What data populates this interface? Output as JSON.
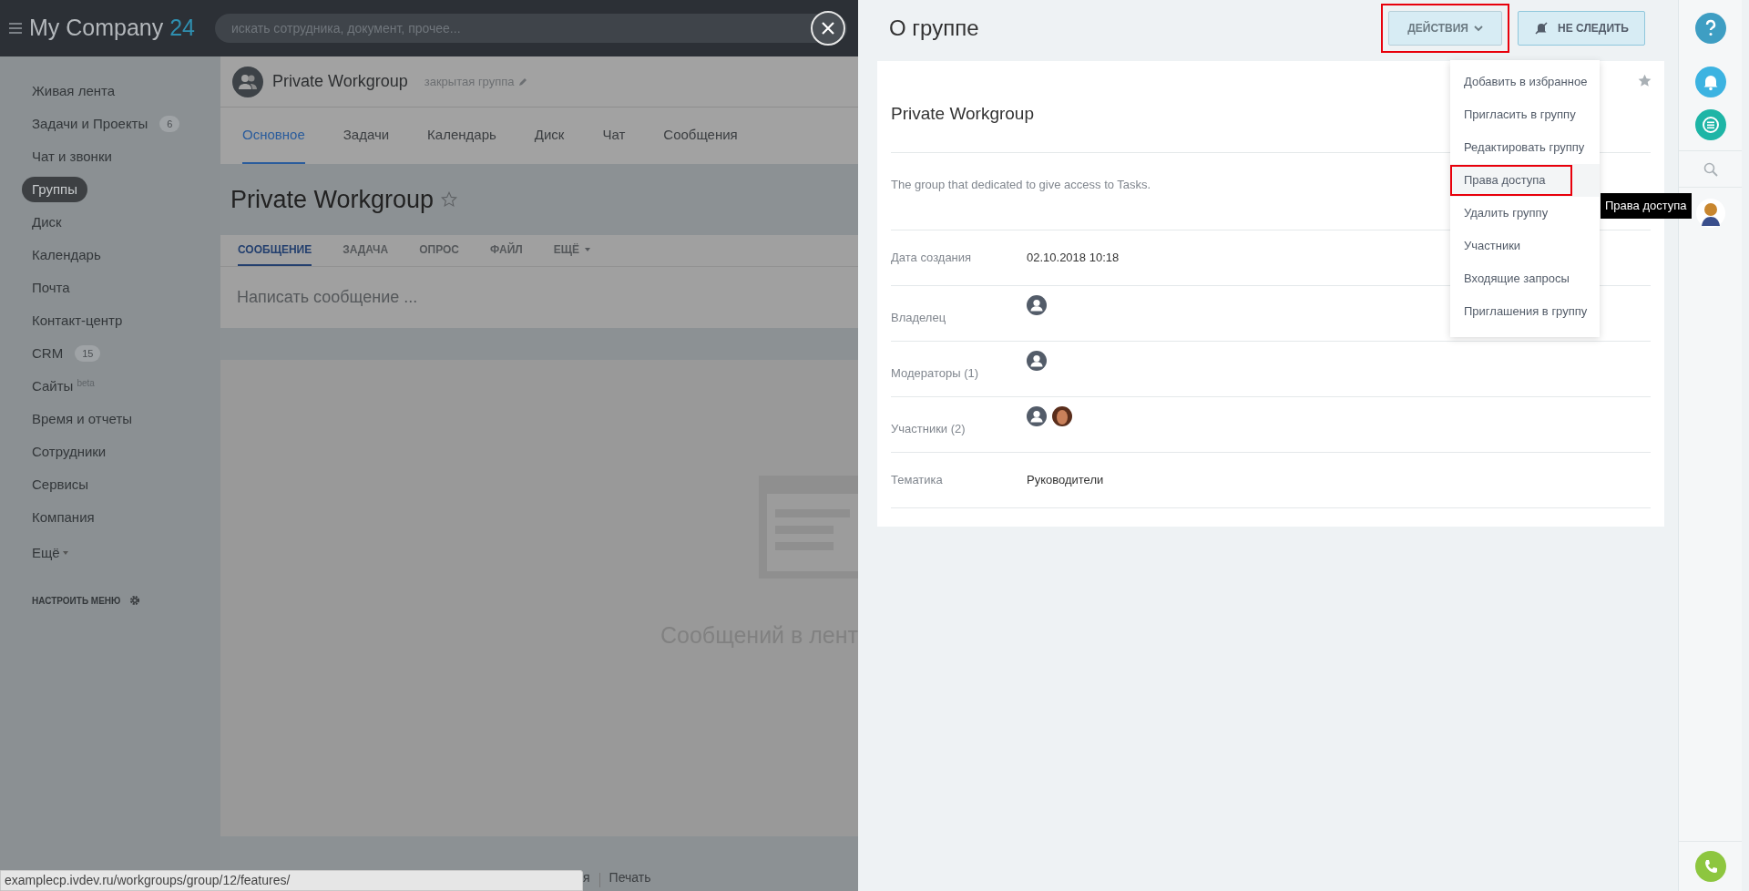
{
  "header": {
    "logo": "My Company",
    "logo_number": "24",
    "search_placeholder": "искать сотрудника, документ, прочее..."
  },
  "sidebar": {
    "items": [
      {
        "label": "Живая лента",
        "selected": false
      },
      {
        "label": "Задачи и Проекты",
        "badge": "6",
        "selected": false
      },
      {
        "label": "Чат и звонки",
        "selected": false
      },
      {
        "label": "Группы",
        "selected": true
      },
      {
        "label": "Диск",
        "selected": false
      },
      {
        "label": "Календарь",
        "selected": false
      },
      {
        "label": "Почта",
        "selected": false
      },
      {
        "label": "Контакт-центр",
        "selected": false
      },
      {
        "label": "CRM",
        "badge": "15",
        "selected": false
      },
      {
        "label": "Сайты",
        "sup": "beta",
        "selected": false
      },
      {
        "label": "Время и отчеты",
        "selected": false
      },
      {
        "label": "Сотрудники",
        "selected": false
      },
      {
        "label": "Сервисы",
        "selected": false
      },
      {
        "label": "Компания",
        "selected": false
      }
    ],
    "more": "Ещё",
    "configure": "НАСТРОИТЬ МЕНЮ"
  },
  "group": {
    "name": "Private Workgroup",
    "type": "закрытая группа",
    "tabs": [
      {
        "label": "Основное",
        "selected": true
      },
      {
        "label": "Задачи",
        "selected": false
      },
      {
        "label": "Календарь",
        "selected": false
      },
      {
        "label": "Диск",
        "selected": false
      },
      {
        "label": "Чат",
        "selected": false
      },
      {
        "label": "Сообщения",
        "selected": false
      }
    ],
    "title": "Private Workgroup",
    "post_tabs": [
      {
        "label": "СООБЩЕНИЕ",
        "selected": true,
        "caret": false
      },
      {
        "label": "ЗАДАЧА",
        "selected": false,
        "caret": false
      },
      {
        "label": "ОПРОС",
        "selected": false,
        "caret": false
      },
      {
        "label": "ФАЙЛ",
        "selected": false,
        "caret": false
      },
      {
        "label": "ЕЩЁ",
        "selected": false,
        "caret": true
      }
    ],
    "post_placeholder": "Написать сообщение ...",
    "empty_text": "Сообщений в лент"
  },
  "footer": {
    "link_fragment": "я",
    "print": "Печать"
  },
  "status_url": "examplecp.ivdev.ru/workgroups/group/12/features/",
  "panel": {
    "title": "О группе",
    "actions_button": {
      "label": "ДЕЙСТВИЯ",
      "highlighted": true
    },
    "follow_button": "НЕ СЛЕДИТЬ",
    "name": "Private Workgroup",
    "description": "The group that dedicated to give access to Tasks.",
    "fields": [
      {
        "label": "Дата создания",
        "kind": "text",
        "value": "02.10.2018 10:18"
      },
      {
        "label": "Владелец",
        "kind": "avatars",
        "avatars": [
          {
            "kind": "silhouette"
          }
        ]
      },
      {
        "label": "Модераторы (1)",
        "kind": "avatars",
        "avatars": [
          {
            "kind": "silhouette"
          }
        ]
      },
      {
        "label": "Участники (2)",
        "kind": "avatars",
        "avatars": [
          {
            "kind": "silhouette"
          },
          {
            "kind": "photo"
          }
        ]
      },
      {
        "label": "Тематика",
        "kind": "text",
        "value": "Руководители"
      }
    ],
    "menu": [
      {
        "label": "Добавить в избранное",
        "selected": false
      },
      {
        "label": "Пригласить в группу",
        "selected": false
      },
      {
        "label": "Редактировать группу",
        "selected": false
      },
      {
        "label": "Права доступа",
        "selected": true
      },
      {
        "label": "Удалить группу",
        "selected": false
      },
      {
        "label": "Участники",
        "selected": false
      },
      {
        "label": "Входящие запросы",
        "selected": false
      },
      {
        "label": "Приглашения в группу",
        "selected": false
      }
    ],
    "tooltip": "Права доступа"
  }
}
